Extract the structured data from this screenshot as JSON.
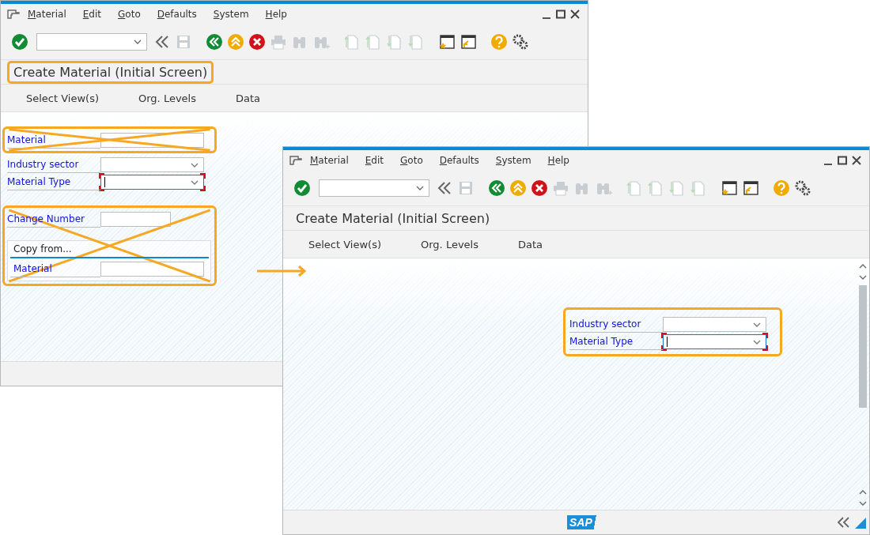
{
  "windows": [
    {
      "menu": [
        "Material",
        "Edit",
        "Goto",
        "Defaults",
        "System",
        "Help"
      ],
      "toolbar": [
        {
          "kind": "enter",
          "disabled": false
        },
        {
          "kind": "command",
          "disabled": false
        },
        {
          "kind": "collapse",
          "disabled": false
        },
        {
          "kind": "save",
          "disabled": true
        },
        {
          "kind": "back",
          "disabled": false
        },
        {
          "kind": "exit",
          "disabled": false
        },
        {
          "kind": "cancel",
          "disabled": false
        },
        {
          "kind": "print",
          "disabled": true
        },
        {
          "kind": "find",
          "disabled": true
        },
        {
          "kind": "find_next",
          "disabled": true
        },
        {
          "kind": "first_page",
          "disabled": true
        },
        {
          "kind": "prev_page",
          "disabled": true
        },
        {
          "kind": "next_page",
          "disabled": true
        },
        {
          "kind": "last_page",
          "disabled": true
        },
        {
          "kind": "new_session",
          "disabled": false
        },
        {
          "kind": "shortcut",
          "disabled": false
        },
        {
          "kind": "help",
          "disabled": false
        },
        {
          "kind": "customize",
          "disabled": false
        }
      ],
      "title": {
        "text": "Create Material (Initial Screen)",
        "highlighted": true
      },
      "app_toolbar": [
        "Select View(s)",
        "Org. Levels",
        "Data"
      ],
      "form": [
        {
          "framed": true,
          "crossed_out": true,
          "fields": [
            {
              "label": "Material",
              "kind": "input",
              "focused": false
            }
          ]
        },
        {
          "framed": false,
          "crossed_out": false,
          "fields": [
            {
              "label": "Industry sector",
              "kind": "dropdown",
              "focused": false
            },
            {
              "label": "Material Type",
              "kind": "dropdown",
              "focused": true
            }
          ]
        },
        {
          "framed": true,
          "crossed_out": true,
          "fields": [
            {
              "label": "Change Number",
              "kind": "short_input",
              "focused": false
            }
          ],
          "group": {
            "title": "Copy from...",
            "fields": [
              {
                "label": "Material",
                "focused": false
              }
            ]
          }
        }
      ],
      "scrollbar": false
    },
    {
      "menu": [
        "Material",
        "Edit",
        "Goto",
        "Defaults",
        "System",
        "Help"
      ],
      "toolbar": [
        {
          "kind": "enter",
          "disabled": false
        },
        {
          "kind": "command",
          "disabled": false
        },
        {
          "kind": "collapse",
          "disabled": false
        },
        {
          "kind": "save",
          "disabled": true
        },
        {
          "kind": "back",
          "disabled": false
        },
        {
          "kind": "exit",
          "disabled": false
        },
        {
          "kind": "cancel",
          "disabled": false
        },
        {
          "kind": "print",
          "disabled": true
        },
        {
          "kind": "find",
          "disabled": true
        },
        {
          "kind": "find_next",
          "disabled": true
        },
        {
          "kind": "first_page",
          "disabled": true
        },
        {
          "kind": "prev_page",
          "disabled": true
        },
        {
          "kind": "next_page",
          "disabled": true
        },
        {
          "kind": "last_page",
          "disabled": true
        },
        {
          "kind": "new_session",
          "disabled": false
        },
        {
          "kind": "shortcut",
          "disabled": false
        },
        {
          "kind": "help",
          "disabled": false
        },
        {
          "kind": "customize",
          "disabled": false
        }
      ],
      "title": {
        "text": "Create Material (Initial Screen)",
        "highlighted": false
      },
      "app_toolbar": [
        "Select View(s)",
        "Org. Levels",
        "Data"
      ],
      "form": [
        {
          "framed": true,
          "crossed_out": false,
          "fields": [
            {
              "label": "Industry sector",
              "kind": "dropdown",
              "focused": false
            },
            {
              "label": "Material Type",
              "kind": "dropdown",
              "focused": true
            }
          ]
        }
      ],
      "scrollbar": true,
      "status_bar": {
        "logo": "SAP"
      }
    }
  ]
}
